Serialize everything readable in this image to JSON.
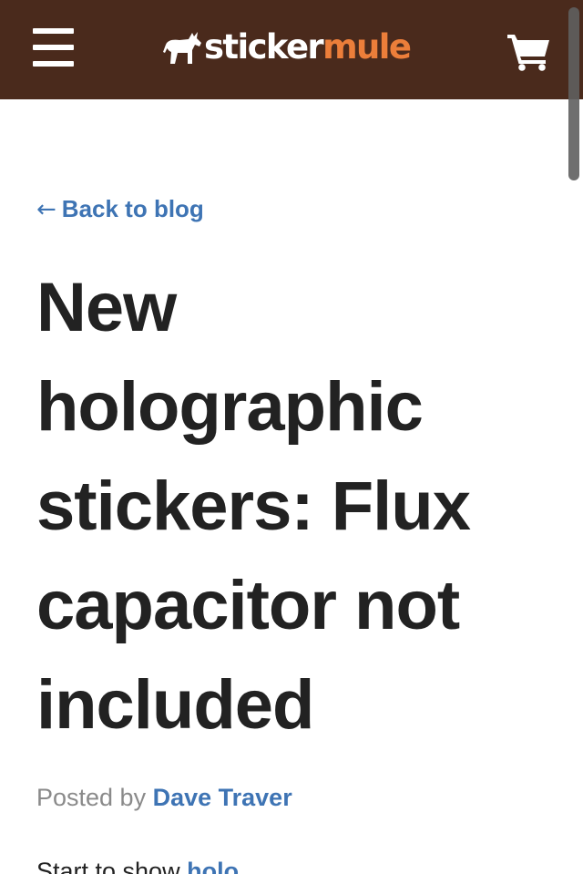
{
  "header": {
    "logo": {
      "part1": "sticker",
      "part2": "mule"
    },
    "icons": {
      "menu": "hamburger-menu-icon",
      "cart": "shopping-cart-icon",
      "logo_mark": "mule-icon"
    },
    "colors": {
      "background": "#4a2a1c",
      "logo_accent": "#ec7e3a"
    }
  },
  "article": {
    "back_link": {
      "arrow": "←",
      "label": "Back to blog"
    },
    "title": "New holographic stickers: Flux capacitor not included",
    "byline": {
      "prefix": "Posted by",
      "author": "Dave Traver"
    },
    "first_line": {
      "text": "Start to show ",
      "link": "holo"
    }
  },
  "colors": {
    "link": "#3e74b4",
    "text": "#222222",
    "muted": "#8a8a8a"
  }
}
